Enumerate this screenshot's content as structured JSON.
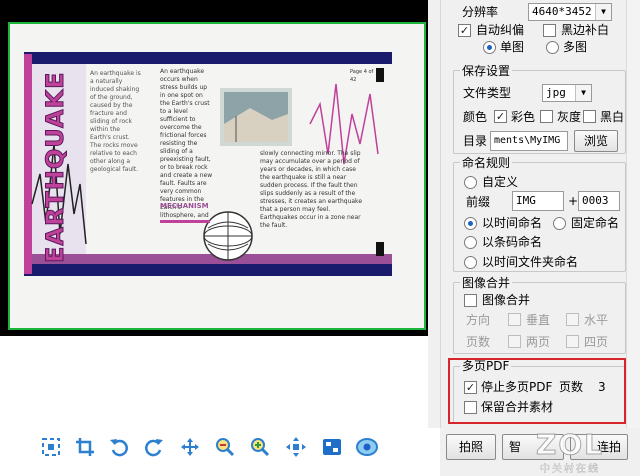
{
  "sidebar": {
    "resolution": {
      "label": "分辨率",
      "value": "4640*3452"
    },
    "auto_deskew": {
      "label": "自动纠偏",
      "checked": true
    },
    "black_edge_fill": {
      "label": "黑边补白",
      "checked": false
    },
    "single_image": {
      "label": "单图",
      "selected": true
    },
    "multi_image": {
      "label": "多图",
      "selected": false
    },
    "save_settings": {
      "title": "保存设置",
      "file_type_label": "文件类型",
      "file_type_value": "jpg",
      "color_label": "颜色",
      "color_option": {
        "label": "彩色",
        "checked": true
      },
      "gray_option": {
        "label": "灰度",
        "checked": false
      },
      "bw_option": {
        "label": "黑白",
        "checked": false
      },
      "dir_label": "目录",
      "dir_value": "ments\\MyIMG",
      "browse_label": "浏览"
    },
    "naming": {
      "title": "命名规则",
      "custom": {
        "label": "自定义",
        "selected": false
      },
      "prefix_label": "前缀",
      "prefix_value": "IMG",
      "plus": "+",
      "number_value": "0003",
      "by_time": {
        "label": "以时间命名",
        "selected": true
      },
      "fixed": {
        "label": "固定命名",
        "selected": false
      },
      "barcode": {
        "label": "以条码命名",
        "selected": false
      },
      "time_folder": {
        "label": "以时间文件夹命名",
        "selected": false
      }
    },
    "merge": {
      "title": "图像合并",
      "merge_check": {
        "label": "图像合并",
        "checked": false
      },
      "direction_label": "方向",
      "vertical_label": "垂直",
      "horizontal_label": "水平",
      "pages_label": "页数",
      "two_pages_label": "两页",
      "four_pages_label": "四页"
    },
    "multipage_pdf": {
      "title": "多页PDF",
      "stop": {
        "label": "停止多页PDF",
        "checked": true
      },
      "page_count_label": "页数",
      "page_count_value": "3",
      "keep": {
        "label": "保留合并素材",
        "checked": false
      }
    }
  },
  "buttons": {
    "capture": "拍照",
    "smart": "智",
    "continuous": "连拍"
  },
  "watermark": {
    "logo": "ZOL",
    "sub": "中关村在线"
  },
  "toolbar_icons": [
    "select-icon",
    "crop-icon",
    "rotate-left-icon",
    "rotate-right-icon",
    "move-icon",
    "zoom-out-icon",
    "zoom-in-icon",
    "fit-icon",
    "fullscreen-icon",
    "view-icon"
  ],
  "document": {
    "headline": "EARTHQUAKE",
    "mechanism": "MECHANISM",
    "page_info": "Page 4 of 42",
    "body_left": "An earthquake occurs when stress builds up in one spot on the Earth's crust to a level sufficient to overcome the frictional forces resisting the sliding of a preexisting fault, or to break rock and create a new fault. Faults are very common features in the Earth's lithosphere, and many millions have been mapped worldwide. Faults are very commonly linear in length, from less than a meter to thousands of kilometers. Most earthquakes occur on preexisting faults. Slip on faults acts to release the stress that builds up in the lithosphere as it is deformed by motions of the Earth's plates.",
    "body_right": "slowly connecting mirror. The slip may accumulate over a period of years or decades, in which case the earthquake is still a near sudden process. If the fault then slips suddenly as a result of the stresses, it creates an earthquake that a person may feel. Earthquakes occur in a zone near the fault.",
    "side_note": "An earthquake is a naturally induced shaking of the ground, caused by the fracture and sliding of rock within the Earth's crust. The rocks move relative to each other along a geological fault."
  }
}
